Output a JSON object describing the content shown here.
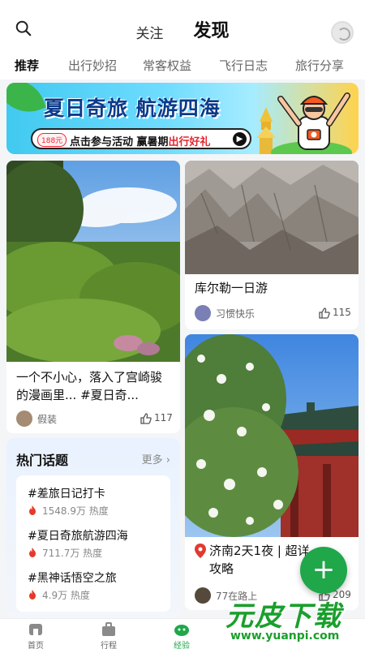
{
  "header": {
    "tabs": [
      {
        "label": "关注",
        "active": false
      },
      {
        "label": "发现",
        "active": true
      }
    ]
  },
  "categories": [
    {
      "label": "推荐",
      "active": true
    },
    {
      "label": "出行妙招",
      "active": false
    },
    {
      "label": "常客权益",
      "active": false
    },
    {
      "label": "飞行日志",
      "active": false
    },
    {
      "label": "旅行分享",
      "active": false
    }
  ],
  "banner": {
    "title": "夏日奇旅 航游四海",
    "price_tag": "188元",
    "pill_text_left": "点击参与活动 赢暑期",
    "pill_text_highlight": "出行好礼"
  },
  "cards": {
    "left1": {
      "title": "一个不小心，落入了宫崎骏的漫画里... #夏日奇...",
      "author": "假装",
      "likes": "117"
    },
    "right1": {
      "title": "库尔勒一日游",
      "author": "习惯快乐",
      "likes": "115"
    },
    "right2": {
      "title": "济南2天1夜 | 超详攻略",
      "author": "77在路上",
      "likes": "209"
    }
  },
  "topics": {
    "heading": "热门话题",
    "more": "更多",
    "items": [
      {
        "name": "#差旅日记打卡",
        "heat": "1548.9万 热度"
      },
      {
        "name": "#夏日奇旅航游四海",
        "heat": "711.7万 热度"
      },
      {
        "name": "#黑神话悟空之旅",
        "heat": "4.9万 热度"
      }
    ]
  },
  "bottom_nav": [
    {
      "label": "首页",
      "icon": "home-icon",
      "active": false
    },
    {
      "label": "行程",
      "icon": "suitcase-icon",
      "active": false
    },
    {
      "label": "经验",
      "icon": "discover-icon",
      "active": true
    },
    {
      "label": "",
      "icon": "",
      "active": false
    },
    {
      "label": "",
      "icon": "",
      "active": false
    }
  ],
  "watermark": {
    "text": "元皮下载",
    "url": "www.yuanpi.com"
  },
  "colors": {
    "accent": "#1fa74a",
    "banner_text": "#0b3a8a",
    "highlight": "#e4262f"
  }
}
